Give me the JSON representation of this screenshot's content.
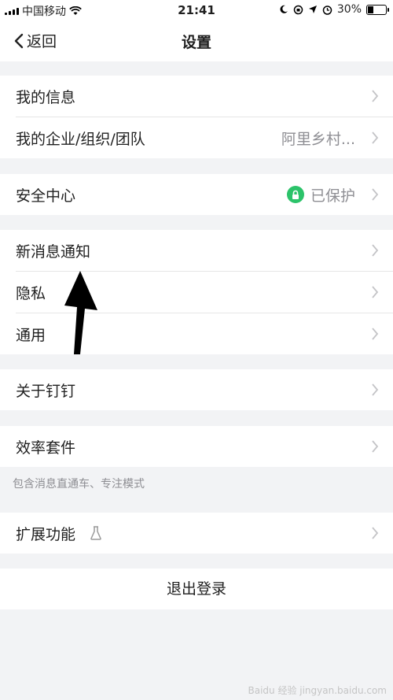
{
  "status_bar": {
    "carrier": "中国移动",
    "time": "21:41",
    "battery_text": "30%",
    "battery_level": 0.3
  },
  "nav": {
    "back_label": "返回",
    "title": "设置"
  },
  "groups": {
    "g1": [
      {
        "label": "我的信息"
      },
      {
        "label": "我的企业/组织/团队",
        "value": "阿里乡村..."
      }
    ],
    "g2": [
      {
        "label": "安全中心",
        "value": "已保护"
      }
    ],
    "g3": [
      {
        "label": "新消息通知"
      },
      {
        "label": "隐私"
      },
      {
        "label": "通用"
      }
    ],
    "g4": [
      {
        "label": "关于钉钉"
      }
    ],
    "g5": [
      {
        "label": "效率套件",
        "hint": "包含消息直通车、专注模式"
      }
    ],
    "g6": [
      {
        "label": "扩展功能"
      }
    ]
  },
  "logout_label": "退出登录",
  "watermark": "Baidu 经验 jingyan.baidu.com",
  "colors": {
    "accent_green": "#2cc36a",
    "background": "#f2f3f5"
  }
}
